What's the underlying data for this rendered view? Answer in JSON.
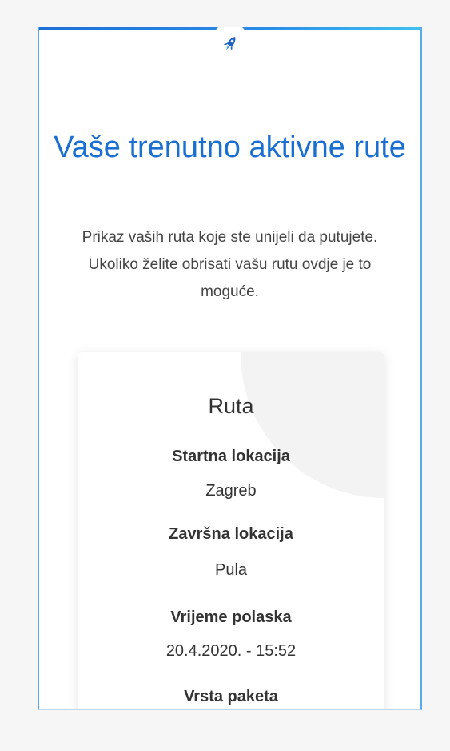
{
  "header": {
    "title": "Vaše trenutno aktivne rute",
    "subtitle": "Prikaz vaših ruta koje ste unijeli da putujete. Ukoliko želite obrisati vašu rutu ovdje je to moguće.",
    "icon": "rocket-icon",
    "accent_color": "#1a6fd3"
  },
  "route_card": {
    "title": "Ruta",
    "fields": [
      {
        "label": "Startna lokacija",
        "value": "Zagreb"
      },
      {
        "label": "Završna lokacija",
        "value": "Pula"
      },
      {
        "label": "Vrijeme polaska",
        "value": "20.4.2020. - 15:52"
      },
      {
        "label": "Vrsta paketa",
        "value": ""
      }
    ]
  }
}
